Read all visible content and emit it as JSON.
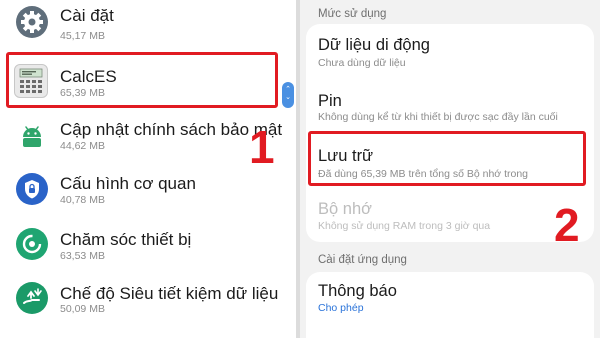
{
  "left_panel": {
    "apps": [
      {
        "name": "Cài đặt",
        "size": "45,17 MB",
        "icon": "settings-gear-icon"
      },
      {
        "name": "CalcES",
        "size": "65,39 MB",
        "icon": "calculator-icon"
      },
      {
        "name": "Cập nhật chính sách bảo mật",
        "size": "44,62 MB",
        "icon": "android-icon"
      },
      {
        "name": "Cấu hình cơ quan",
        "size": "40,78 MB",
        "icon": "shield-icon"
      },
      {
        "name": "Chăm sóc thiết bị",
        "size": "63,53 MB",
        "icon": "device-care-icon"
      },
      {
        "name": "Chế độ Siêu tiết kiệm dữ liệu",
        "size": "50,09 MB",
        "icon": "data-saver-icon"
      }
    ],
    "step_number": "1",
    "colors": {
      "settings": "#5f6e7b",
      "android": "#2fa56b",
      "shield": "#2a63c8",
      "care": "#1fa572",
      "datasaver": "#1b9a68",
      "highlight": "#e11b22"
    }
  },
  "right_panel": {
    "usage_section_title": "Mức sử dụng",
    "mobile_data": {
      "title": "Dữ liệu di động",
      "sub": "Chưa dùng dữ liệu"
    },
    "battery": {
      "title": "Pin",
      "sub": "Không dùng kể từ khi thiết bị được sạc đầy lần cuối"
    },
    "storage": {
      "title": "Lưu trữ",
      "sub": "Đã dùng 65,39 MB trên tổng số Bộ nhớ trong"
    },
    "memory": {
      "title": "Bộ nhớ",
      "sub": "Không sử dụng RAM trong 3 giờ qua"
    },
    "app_settings_title": "Cài đặt ứng dụng",
    "notifications": {
      "title": "Thông báo",
      "sub": "Cho phép"
    },
    "step_number": "2"
  }
}
